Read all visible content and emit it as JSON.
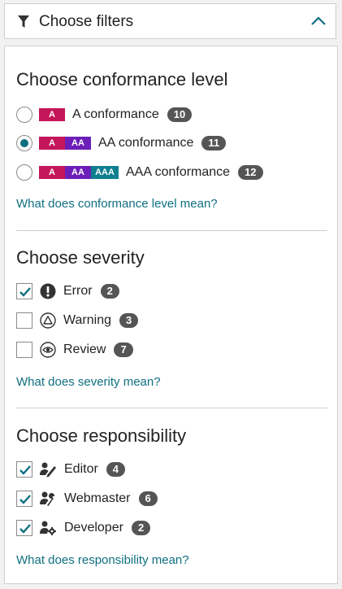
{
  "header": {
    "title": "Choose filters"
  },
  "conformance": {
    "title": "Choose conformance level",
    "options": [
      {
        "label": "A conformance",
        "count": "10",
        "selected": false,
        "chips": [
          "A"
        ]
      },
      {
        "label": "AA conformance",
        "count": "11",
        "selected": true,
        "chips": [
          "A",
          "AA"
        ]
      },
      {
        "label": "AAA conformance",
        "count": "12",
        "selected": false,
        "chips": [
          "A",
          "AA",
          "AAA"
        ]
      }
    ],
    "link": "What does conformance level mean?"
  },
  "severity": {
    "title": "Choose severity",
    "options": [
      {
        "label": "Error",
        "count": "2",
        "checked": true,
        "icon": "error-icon"
      },
      {
        "label": "Warning",
        "count": "3",
        "checked": false,
        "icon": "warning-icon"
      },
      {
        "label": "Review",
        "count": "7",
        "checked": false,
        "icon": "review-eye-icon"
      }
    ],
    "link": "What does severity mean?"
  },
  "responsibility": {
    "title": "Choose responsibility",
    "options": [
      {
        "label": "Editor",
        "count": "4",
        "checked": true,
        "icon": "editor-icon"
      },
      {
        "label": "Webmaster",
        "count": "6",
        "checked": true,
        "icon": "webmaster-icon"
      },
      {
        "label": "Developer",
        "count": "2",
        "checked": true,
        "icon": "developer-icon"
      }
    ],
    "link": "What does responsibility mean?"
  },
  "colors": {
    "accent": "#0f6f80",
    "chip_a": "#c4165b",
    "chip_aa": "#6c1fb8",
    "chip_aaa": "#0f7f8f",
    "badge": "#555555"
  }
}
